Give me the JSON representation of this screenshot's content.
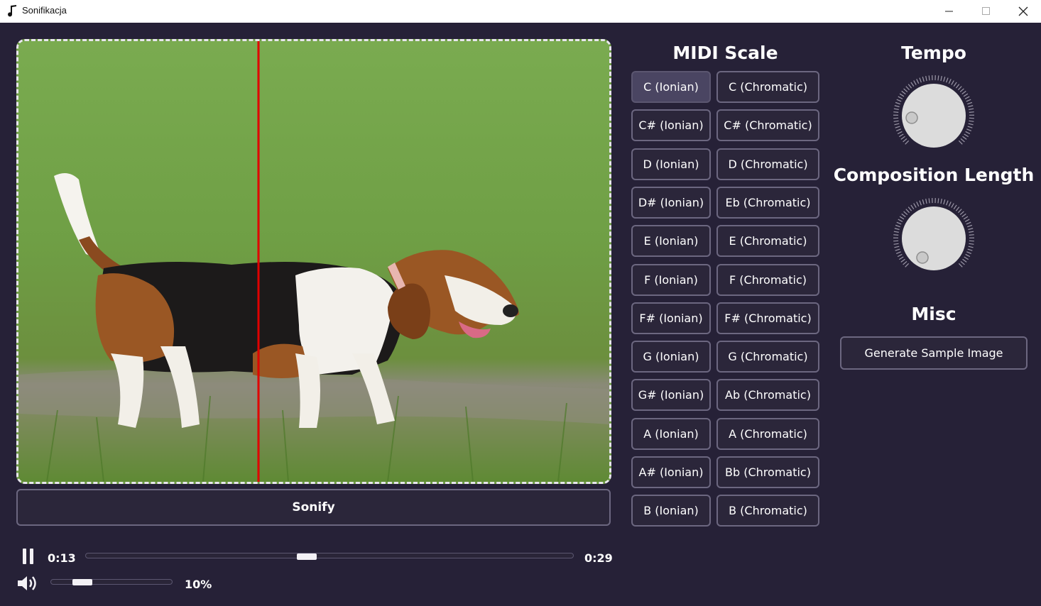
{
  "window": {
    "title": "Sonifikacja",
    "icons": {
      "app": "music-note-icon",
      "minimize": "minimize-icon",
      "maximize": "maximize-icon",
      "close": "close-icon"
    }
  },
  "image": {
    "description_icon": "beagle-photo",
    "playhead_color": "#e00000"
  },
  "sonify_label": "Sonify",
  "player": {
    "current_time": "0:13",
    "total_time": "0:29",
    "progress": 0.45,
    "volume_label": "10%",
    "volume": 0.1,
    "play_state_icon": "pause-icon",
    "volume_icon": "speaker-icon"
  },
  "midi": {
    "heading": "MIDI Scale",
    "selected": "C (Ionian)",
    "rows": [
      [
        "C (Ionian)",
        "C (Chromatic)"
      ],
      [
        "C# (Ionian)",
        "C# (Chromatic)"
      ],
      [
        "D (Ionian)",
        "D (Chromatic)"
      ],
      [
        "D# (Ionian)",
        "Eb (Chromatic)"
      ],
      [
        "E (Ionian)",
        "E (Chromatic)"
      ],
      [
        "F (Ionian)",
        "F (Chromatic)"
      ],
      [
        "F# (Ionian)",
        "F# (Chromatic)"
      ],
      [
        "G (Ionian)",
        "G (Chromatic)"
      ],
      [
        "G# (Ionian)",
        "Ab (Chromatic)"
      ],
      [
        "A (Ionian)",
        "A (Chromatic)"
      ],
      [
        "A# (Ionian)",
        "Bb (Chromatic)"
      ],
      [
        "B (Ionian)",
        "B (Chromatic)"
      ]
    ]
  },
  "tempo": {
    "heading": "Tempo"
  },
  "composition": {
    "heading": "Composition Length"
  },
  "misc": {
    "heading": "Misc",
    "generate_label": "Generate Sample Image"
  },
  "colors": {
    "background": "#262137",
    "button_bg": "#2b263a",
    "button_border": "#6c6780",
    "selected_bg": "#4a4562"
  }
}
